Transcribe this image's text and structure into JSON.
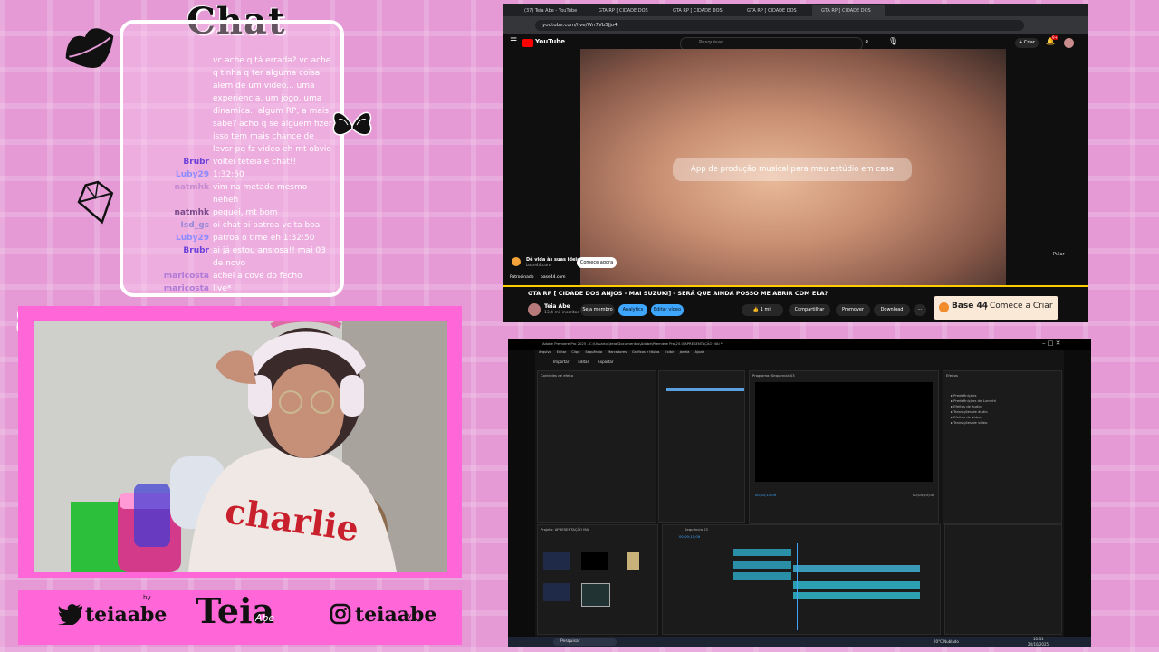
{
  "chat": {
    "title": "Chat",
    "messages": [
      {
        "user": "",
        "text": "vc ache q tá errada? vc ache q tinha q ter alguma coisa alem de um video... uma experiencia, um jogo, uma dinamica.. algum RP, a mais, sabe? acho q se alguem fizer isso tem mais chance de levsr pq fz video eh mt obvio",
        "color": "#ffffff"
      },
      {
        "user": "Brubr",
        "text": "voltei teteia e chat!!",
        "color": "#6a3fd8"
      },
      {
        "user": "Luby29",
        "text": "1:32:50",
        "color": "#8c8cff"
      },
      {
        "user": "natmhk",
        "text": "vim na metade mesmo neheh",
        "color": "#c58ad1"
      },
      {
        "user": "natmhk",
        "text": "peguei, mt bom",
        "color": "#7a4a8a"
      },
      {
        "user": "Isd_gs",
        "text": "oi chat oi patroa vc ta boa",
        "color": "#9a8ad8"
      },
      {
        "user": "Luby29",
        "text": "patroa o time eh 1:32:50",
        "color": "#8c8cff"
      },
      {
        "user": "Brubr",
        "text": "ai já estou ansiosa!! mai 03 de novo",
        "color": "#6a3fd8"
      },
      {
        "user": "maricosta",
        "text": "achei a cove do fecho",
        "color": "#b07ad8"
      },
      {
        "user": "maricosta",
        "text": "live*",
        "color": "#b07ad8"
      }
    ]
  },
  "overlay": {
    "twitter_handle": "teiaabe",
    "logo_text": "Teia",
    "logo_sub": "Abe",
    "instagram_handle": "teiaabe",
    "by_label": "by"
  },
  "youtube": {
    "tabs": [
      "(37) Teia Abe - YouTube",
      "GTA RP [ CIDADE DOS ANJOS - MAI",
      "GTA RP [ CIDADE DOS ANJOS",
      "GTA RP [ CIDADE DOS ANJOS",
      "GTA RP [ CIDADE DOS ANJOS"
    ],
    "url": "youtube.com/live/Wn7Vb5Jjo4",
    "logo": "YouTube",
    "search_placeholder": "Pesquisar",
    "create_label": "Criar",
    "notif_count": "9+",
    "ad_text": "App de produção musical para meu estúdio em casa",
    "ad_brand": "Dê vida às suas ideias",
    "ad_brand_sub": "base44.com",
    "ad_cta": "Comece agora",
    "sponsored": "Patrocinado",
    "sponsored_site": "base44.com",
    "skip": "Pular",
    "video_title": "GTA RP [ CIDADE DOS ANJOS - MAI SUZUKI] - SERÁ QUE AINDA POSSO ME ABRIR COM ELA?",
    "channel_name": "Teia Abe",
    "subscribers": "13,4 mil inscritos",
    "join_label": "Seja membro",
    "analytics_label": "Analytics",
    "edit_label": "Editar vídeo",
    "likes": "1 mil",
    "share_label": "Compartilhar",
    "promote_label": "Promover",
    "download_label": "Download",
    "banner_brand": "Base 44",
    "banner_cta": "Comece a Criar"
  },
  "premiere": {
    "title": "Adobe Premiere Pro 2025 - C:\\Usuarios\\teia\\Documentos\\Adobe\\Premiere Pro\\25.0\\APRESENTAÇÃO MAI *",
    "menu": [
      "Arquivo",
      "Editar",
      "Clipe",
      "Sequência",
      "Marcadores",
      "Gráficos e títulos",
      "Exibir",
      "Janela",
      "Ajuda"
    ],
    "tabs": [
      "Importar",
      "Editar",
      "Exportar"
    ],
    "source_panel": "Controles de efeito",
    "program_panel": "Programa: Sequência 03",
    "effects_panel": "Efeitos",
    "project_panel": "Projeto: APRESENTAÇÃO MAI",
    "sequence_tab": "Sequência 03",
    "timecode": "00;00;15;09",
    "duration": "00;04;25;00",
    "taskbar_search": "Pesquisar",
    "weather": "20°C  Nublado",
    "clock": "10:31",
    "date": "24/10/2025",
    "effects_folders": [
      "Predefinições",
      "Predefinições de Lumetri",
      "Efeitos de áudio",
      "Transições de áudio",
      "Efeitos de vídeo",
      "Transições de vídeo"
    ]
  },
  "colors": {
    "background": "#e59ad6",
    "frame": "#ff66d8",
    "accent": "#ffffff"
  }
}
